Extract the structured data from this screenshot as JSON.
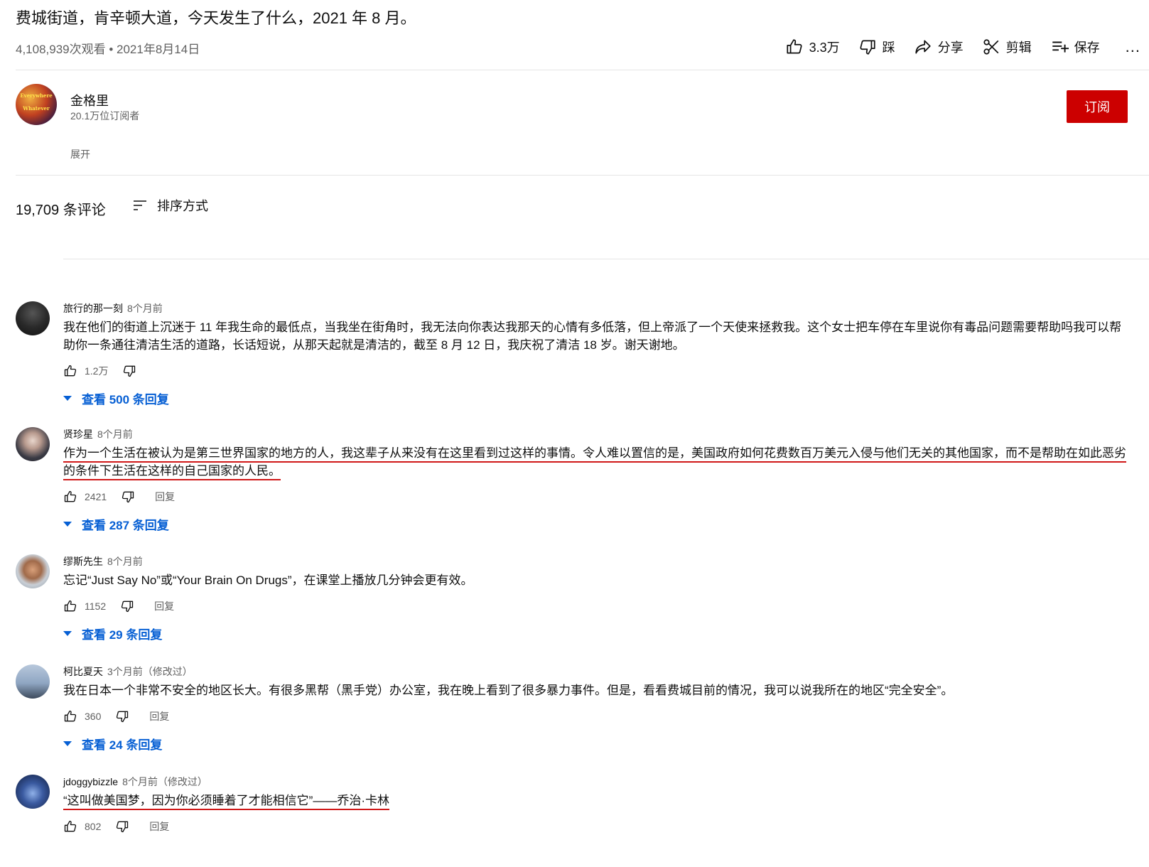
{
  "video": {
    "title": "费城街道，肯辛顿大道，今天发生了什么，2021 年 8 月。",
    "meta": "4,108,939次观看 • 2021年8月14日"
  },
  "actions": {
    "like": "3.3万",
    "dislike": "踩",
    "share": "分享",
    "clip": "剪辑",
    "save": "保存",
    "more": "..."
  },
  "channel": {
    "name": "金格里",
    "subscribers": "20.1万位订阅者",
    "subscribe_label": "订阅",
    "expand_label": "展开",
    "avatar_text_1": "Everywhere",
    "avatar_text_2": "Whatever"
  },
  "comments_header": {
    "count": "19,709 条评论",
    "sort_label": "排序方式"
  },
  "comments": [
    {
      "author": "旅行的那一刻",
      "time": "8个月前",
      "text": "我在他们的街道上沉迷于 11 年我生命的最低点，当我坐在街角时，我无法向你表达我那天的心情有多低落，但上帝派了一个天使来拯救我。这个女士把车停在车里说你有毒品问题需要帮助吗我可以帮助你一条通往清洁生活的道路，长话短说，从那天起就是清洁的，截至 8 月 12 日，我庆祝了清洁 18 岁。谢天谢地。",
      "likes": "1.2万",
      "reply": "",
      "replies": "查看 500 条回复"
    },
    {
      "author": "贤珍星",
      "time": "8个月前",
      "text": "作为一个生活在被认为是第三世界国家的地方的人，我这辈子从来没有在这里看到过这样的事情。令人难以置信的是，美国政府如何花费数百万美元入侵与他们无关的其他国家，而不是帮助在如此恶劣的条件下生活在这样的自己国家的人民。",
      "likes": "2421",
      "reply": "回复",
      "replies": "查看 287 条回复"
    },
    {
      "author": "缪斯先生",
      "time": "8个月前",
      "text": "忘记“Just Say No”或“Your Brain On Drugs”，在课堂上播放几分钟会更有效。",
      "likes": "1152",
      "reply": "回复",
      "replies": "查看 29 条回复"
    },
    {
      "author": "柯比夏天",
      "time": "3个月前（修改过）",
      "text": "我在日本一个非常不安全的地区长大。有很多黑帮（黑手党）办公室，我在晚上看到了很多暴力事件。但是，看看费城目前的情况，我可以说我所在的地区“完全安全”。",
      "likes": "360",
      "reply": "回复",
      "replies": "查看 24 条回复"
    },
    {
      "author": "jdoggybizzle",
      "time": "8个月前（修改过）",
      "text": "“这叫做美国梦，因为你必须睡着了才能相信它”——乔治·卡林",
      "likes": "802",
      "reply": "回复",
      "replies": ""
    }
  ],
  "colors": {
    "subscribe": "#cc0000",
    "link": "#065fd4",
    "underline": "#d01818"
  }
}
